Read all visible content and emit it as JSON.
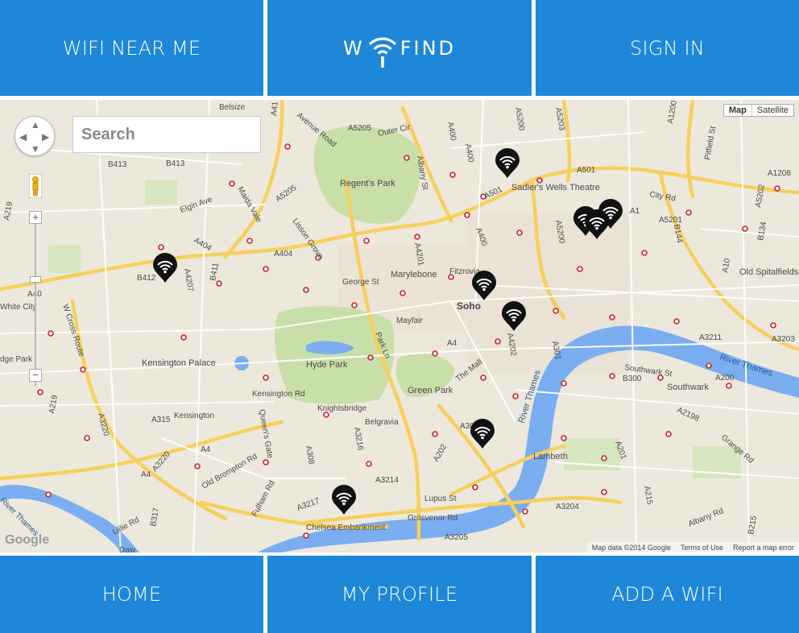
{
  "header": {
    "wifi_near_me": "WIFI NEAR ME",
    "logo_left": "W",
    "logo_right": "FIND",
    "sign_in": "SIGN IN"
  },
  "footer": {
    "home": "HOME",
    "my_profile": "MY PROFILE",
    "add_wifi": "ADD A WIFI"
  },
  "colors": {
    "brand_blue": "#1e87d8",
    "map_bg": "#ede8dc",
    "park": "#c8dfa8",
    "river": "#7aaef0",
    "major_road": "#f6cf5c",
    "pin": "#111111"
  },
  "map": {
    "search_placeholder": "Search",
    "map_type": {
      "map": "Map",
      "satellite": "Satellite",
      "selected": "Map"
    },
    "zoom_in": "+",
    "zoom_out": "−",
    "google": "Google",
    "attribution": {
      "data": "Map data ©2014 Google",
      "terms": "Terms of Use",
      "report": "Report a map error"
    },
    "labels": [
      "Regent's Park",
      "Hyde Park",
      "Green Park",
      "Kensington Palace",
      "Marylebone",
      "Soho",
      "Mayfair",
      "Fitzrovia",
      "Sadler's Wells Theatre",
      "Lambeth",
      "Southwark",
      "Knightsbridge",
      "Belgravia",
      "Kensington",
      "White City",
      "River Thames",
      "City Rd",
      "Old Spitalfields",
      "Chelsea Embankment",
      "Grosvenor Rd",
      "Lupus St",
      "George St",
      "Kensington Rd",
      "Old Brompton Rd",
      "Fulham Rd",
      "Lisson Grove",
      "Maida Vale",
      "Elgin Ave",
      "W Cross Route",
      "Queen's Gate",
      "Park Ln",
      "The Mall",
      "Southwark St",
      "Albany St",
      "Avenue Road",
      "Outer Cir",
      "Lillie Rd",
      "Grange Rd",
      "Albany Rd",
      "Pitfield St",
      "B300",
      "B413",
      "B412",
      "A40",
      "A41",
      "A404",
      "A5205",
      "A501",
      "A1",
      "A5201",
      "A3211",
      "A4",
      "A315",
      "A3220",
      "A3217",
      "A3214",
      "A3205",
      "A202",
      "A3204",
      "A201",
      "A215",
      "A2198",
      "A200",
      "A3216",
      "A308",
      "A4201",
      "A400",
      "A5200",
      "A1200",
      "A1208",
      "B144",
      "B134",
      "A10",
      "A219",
      "A302",
      "A301",
      "B317",
      "B215",
      "A5203",
      "Belsize",
      "Daw",
      "A4207",
      "B411",
      "River Thames",
      "A3203",
      "A4202"
    ],
    "wifi_spots": 10
  }
}
